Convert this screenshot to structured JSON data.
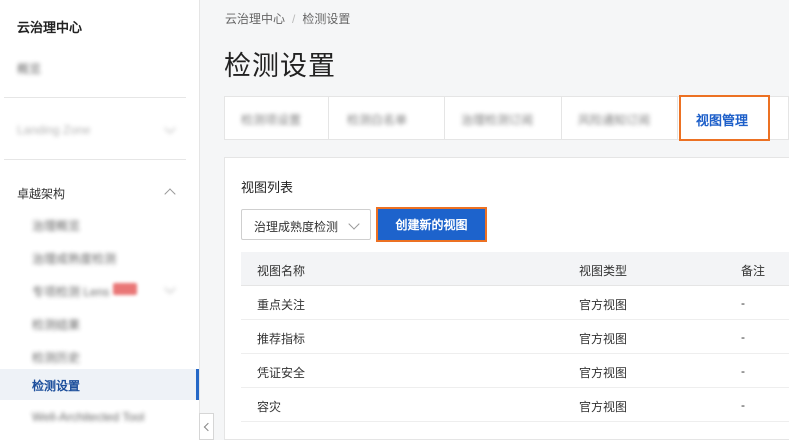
{
  "sidebar": {
    "title": "云治理中心",
    "overview": "概览",
    "landing_zone": "Landing Zone",
    "group_label": "卓越架构",
    "sub_items": [
      "治理概览",
      "治理成熟度检测",
      "专项检测 Lens",
      "检测结果",
      "检测历史"
    ],
    "active_item": "检测设置",
    "bottom_item": "Well-Architected Tool"
  },
  "breadcrumb": {
    "root": "云治理中心",
    "current": "检测设置"
  },
  "page_title": "检测设置",
  "tabs": [
    "检测项设置",
    "检测白名单",
    "治理检测订阅",
    "风险通知订阅",
    "视图管理"
  ],
  "views": {
    "section_title": "视图列表",
    "select_value": "治理成熟度检测",
    "create_button": "创建新的视图",
    "columns": [
      "视图名称",
      "视图类型",
      "备注"
    ],
    "rows": [
      {
        "name": "重点关注",
        "type": "官方视图",
        "note": "-"
      },
      {
        "name": "推荐指标",
        "type": "官方视图",
        "note": "-"
      },
      {
        "name": "凭证安全",
        "type": "官方视图",
        "note": "-"
      },
      {
        "name": "容灾",
        "type": "官方视图",
        "note": "-"
      }
    ]
  }
}
